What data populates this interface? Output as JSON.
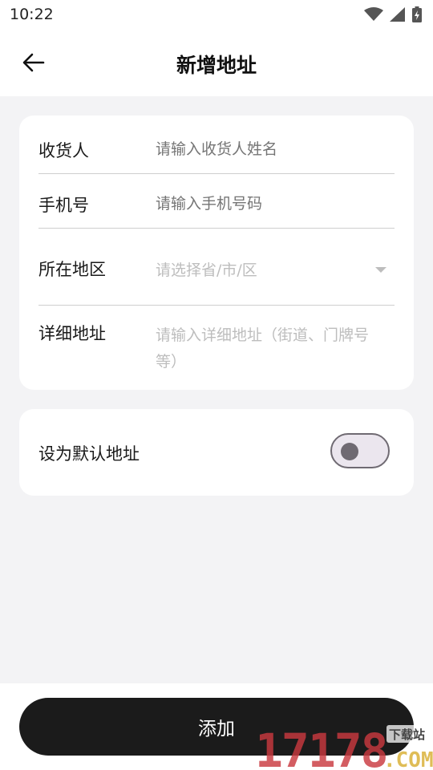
{
  "status_bar": {
    "time": "10:22"
  },
  "header": {
    "title": "新增地址"
  },
  "form": {
    "receiver": {
      "label": "收货人",
      "placeholder": "请输入收货人姓名"
    },
    "phone": {
      "label": "手机号",
      "placeholder": "请输入手机号码"
    },
    "region": {
      "label": "所在地区",
      "placeholder": "请选择省/市/区"
    },
    "detail": {
      "label": "详细地址",
      "placeholder_line1": "请输入详细地址（街道、门牌号",
      "placeholder_line2": "等）"
    }
  },
  "default_address": {
    "label": "设为默认地址",
    "enabled": false
  },
  "submit": {
    "label": "添加"
  },
  "watermark": {
    "number": "17178",
    "suffix": ".COM",
    "badge": "下载站"
  }
}
